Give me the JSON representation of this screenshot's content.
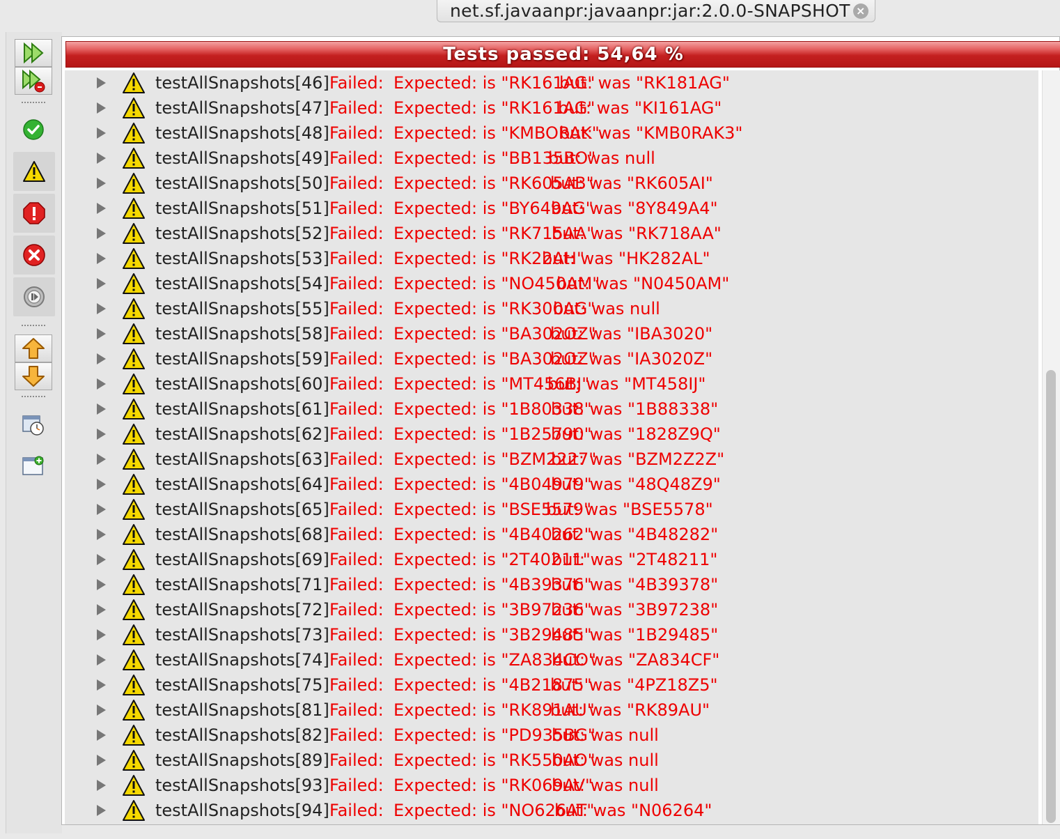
{
  "tab": {
    "title": "net.sf.javaanpr:javaanpr:jar:2.0.0-SNAPSHOT",
    "close_icon": "close-icon"
  },
  "toolbar": {
    "buttons": [
      {
        "name": "rerun-all",
        "icon": "double-play-icon"
      },
      {
        "name": "rerun-failed",
        "icon": "rerun-failed-icon"
      },
      {
        "name": "show-passed",
        "icon": "check-icon"
      },
      {
        "name": "show-warnings",
        "icon": "warning-icon"
      },
      {
        "name": "show-failures",
        "icon": "error-icon"
      },
      {
        "name": "show-errors",
        "icon": "x-circle-icon"
      },
      {
        "name": "show-skipped",
        "icon": "skip-icon"
      },
      {
        "name": "previous-failure",
        "icon": "arrow-up-icon"
      },
      {
        "name": "next-failure",
        "icon": "arrow-down-icon"
      },
      {
        "name": "test-history",
        "icon": "clock-icon"
      },
      {
        "name": "new-tab",
        "icon": "new-tab-icon"
      }
    ]
  },
  "progress": {
    "label": "Tests passed: 54,64 %",
    "fraction": 0.5464,
    "color": "#c42020"
  },
  "colors": {
    "failure_text": "#ee0000",
    "name_text": "#222222",
    "warning_fill": "#f5d800"
  },
  "rows": [
    {
      "name": "testAllSnapshots[46]",
      "status": "Failed:",
      "expected": "Expected: is \"RK161AG\"",
      "actual": "but: was \"RK181AG\""
    },
    {
      "name": "testAllSnapshots[47]",
      "status": "Failed:",
      "expected": "Expected: is \"RK161AG\"",
      "actual": "but: was \"KI161AG\""
    },
    {
      "name": "testAllSnapshots[48]",
      "status": "Failed:",
      "expected": "Expected: is \"KMBORAK\"",
      "actual": "but: was \"KMB0RAK3\""
    },
    {
      "name": "testAllSnapshots[49]",
      "status": "Failed:",
      "expected": "Expected: is \"BB135BO\"",
      "actual": "but: was null"
    },
    {
      "name": "testAllSnapshots[50]",
      "status": "Failed:",
      "expected": "Expected: is \"RK605AB\"",
      "actual": "but: was \"RK605AI\""
    },
    {
      "name": "testAllSnapshots[51]",
      "status": "Failed:",
      "expected": "Expected: is \"BY649AG\"",
      "actual": "but: was \"8Y849A4\""
    },
    {
      "name": "testAllSnapshots[52]",
      "status": "Failed:",
      "expected": "Expected: is \"RK715AA\"",
      "actual": "but: was \"RK718AA\""
    },
    {
      "name": "testAllSnapshots[53]",
      "status": "Failed:",
      "expected": "Expected: is \"RK22AH\"",
      "actual": "but: was \"HK282AL\""
    },
    {
      "name": "testAllSnapshots[54]",
      "status": "Failed:",
      "expected": "Expected: is \"NO450AM\"",
      "actual": "but: was \"N0450AM\""
    },
    {
      "name": "testAllSnapshots[55]",
      "status": "Failed:",
      "expected": "Expected: is \"RK300AG\"",
      "actual": "but: was null"
    },
    {
      "name": "testAllSnapshots[58]",
      "status": "Failed:",
      "expected": "Expected: is \"BA302OZ\"",
      "actual": "but: was \"IBA3020\""
    },
    {
      "name": "testAllSnapshots[59]",
      "status": "Failed:",
      "expected": "Expected: is \"BA302OZ\"",
      "actual": "but: was \"IA3020Z\""
    },
    {
      "name": "testAllSnapshots[60]",
      "status": "Failed:",
      "expected": "Expected: is \"MT456BJ\"",
      "actual": "but: was \"MT458IJ\""
    },
    {
      "name": "testAllSnapshots[61]",
      "status": "Failed:",
      "expected": "Expected: is \"1B80338\"",
      "actual": "but: was \"1B88338\""
    },
    {
      "name": "testAllSnapshots[62]",
      "status": "Failed:",
      "expected": "Expected: is \"1B25790\"",
      "actual": "but: was \"1828Z9Q\""
    },
    {
      "name": "testAllSnapshots[63]",
      "status": "Failed:",
      "expected": "Expected: is \"BZM2227\"",
      "actual": "but: was \"BZM2Z2Z\""
    },
    {
      "name": "testAllSnapshots[64]",
      "status": "Failed:",
      "expected": "Expected: is \"4B04979\"",
      "actual": "but: was \"48Q48Z9\""
    },
    {
      "name": "testAllSnapshots[65]",
      "status": "Failed:",
      "expected": "Expected: is \"BSE5579\"",
      "actual": "but: was \"BSE5578\""
    },
    {
      "name": "testAllSnapshots[68]",
      "status": "Failed:",
      "expected": "Expected: is \"4B40262\"",
      "actual": "but: was \"4B48282\""
    },
    {
      "name": "testAllSnapshots[69]",
      "status": "Failed:",
      "expected": "Expected: is \"2T40211\"",
      "actual": "but: was \"2T48211\""
    },
    {
      "name": "testAllSnapshots[71]",
      "status": "Failed:",
      "expected": "Expected: is \"4B39376\"",
      "actual": "but: was \"4B39378\""
    },
    {
      "name": "testAllSnapshots[72]",
      "status": "Failed:",
      "expected": "Expected: is \"3B97236\"",
      "actual": "but: was \"3B97238\""
    },
    {
      "name": "testAllSnapshots[73]",
      "status": "Failed:",
      "expected": "Expected: is \"3B29485\"",
      "actual": "but: was \"1B29485\""
    },
    {
      "name": "testAllSnapshots[74]",
      "status": "Failed:",
      "expected": "Expected: is \"ZA834CO\"",
      "actual": "but: was \"ZA834CF\""
    },
    {
      "name": "testAllSnapshots[75]",
      "status": "Failed:",
      "expected": "Expected: is \"4B21875\"",
      "actual": "but: was \"4PZ18Z5\""
    },
    {
      "name": "testAllSnapshots[81]",
      "status": "Failed:",
      "expected": "Expected: is \"RK891AU\"",
      "actual": "but: was \"RK89AU\""
    },
    {
      "name": "testAllSnapshots[82]",
      "status": "Failed:",
      "expected": "Expected: is \"PD935BG\"",
      "actual": "but: was null"
    },
    {
      "name": "testAllSnapshots[89]",
      "status": "Failed:",
      "expected": "Expected: is \"RK550AO\"",
      "actual": "but: was null"
    },
    {
      "name": "testAllSnapshots[93]",
      "status": "Failed:",
      "expected": "Expected: is \"RK069AV\"",
      "actual": "but: was null"
    },
    {
      "name": "testAllSnapshots[94]",
      "status": "Failed:",
      "expected": "Expected: is \"NO626AT\"",
      "actual": "but: was \"N06264\""
    }
  ]
}
